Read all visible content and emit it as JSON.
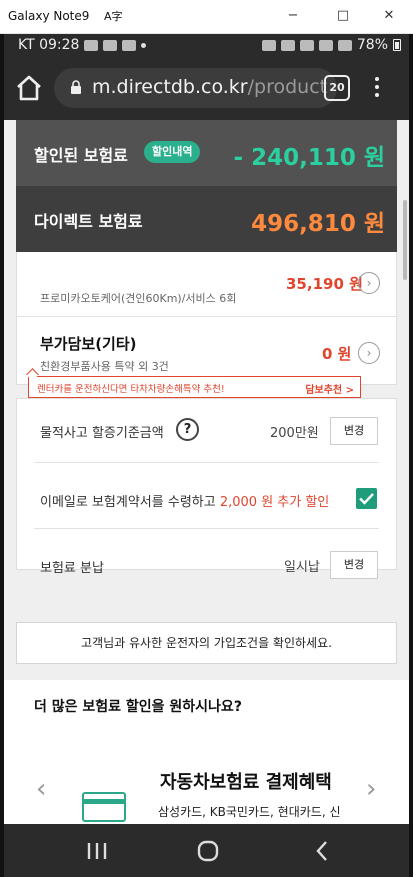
{
  "window": {
    "title": "Galaxy Note9",
    "font_icon": "A字",
    "minimize": "−",
    "maximize": "□",
    "close": "✕"
  },
  "status_bar": {
    "carrier_time": "KT 09:28",
    "battery": "78%",
    "icons": [
      "pass-icon",
      "message-icon",
      "talk-icon",
      "dot-icon",
      "mute-icon",
      "lock-icon",
      "wifi-icon",
      "hd-icon",
      "signal-icon",
      "battery-icon"
    ]
  },
  "browser": {
    "url_host": "m.directdb.co.kr",
    "url_path": "/product",
    "tab_count": "20"
  },
  "summary": {
    "discount_label": "할인된 보험료",
    "discount_badge": "할인내역",
    "discount_value": "- 240,110 원",
    "direct_label": "다이렉트 보험료",
    "direct_value": "496,810 원"
  },
  "coverage_items": [
    {
      "title": "",
      "sub": "프로미카오토케어(견인60Km)/서비스 6회",
      "price": "35,190 원"
    },
    {
      "title": "부가담보(기타)",
      "sub": "친환경부품사용 특약 외 3건",
      "price": "0 원"
    }
  ],
  "promo": {
    "text": "렌터카를 운전하신다면 타차차량손해특약 추천!",
    "link": "담보추천 >"
  },
  "options": {
    "property_label": "물적사고 할증기준금액",
    "property_help": "?",
    "property_value": "200만원",
    "property_change": "변경",
    "email_prefix": "이메일로 보험계약서를 수령하고 ",
    "email_highlight": "2,000 원 추가 할인",
    "email_checked": true,
    "payment_label": "보험료 분납",
    "payment_value": "일시납",
    "payment_change": "변경"
  },
  "notice": "고객님과 유사한 운전자의 가입조건을 확인하세요.",
  "promo_card": {
    "title": "더 많은 보험료 할인을 원하시나요?",
    "benefit_title": "자동차보험료 결제혜택",
    "benefit_desc": "삼성카드, KB국민카드, 현대카드, 신한카드, NH농협카드",
    "prev": "‹",
    "next": "›",
    "active_slide": 1,
    "slide_count": 3
  },
  "colors": {
    "accent_green": "#2bb08e",
    "discount_green": "#2bd0a0",
    "price_orange": "#ff8a3d",
    "price_red": "#e0462e"
  }
}
